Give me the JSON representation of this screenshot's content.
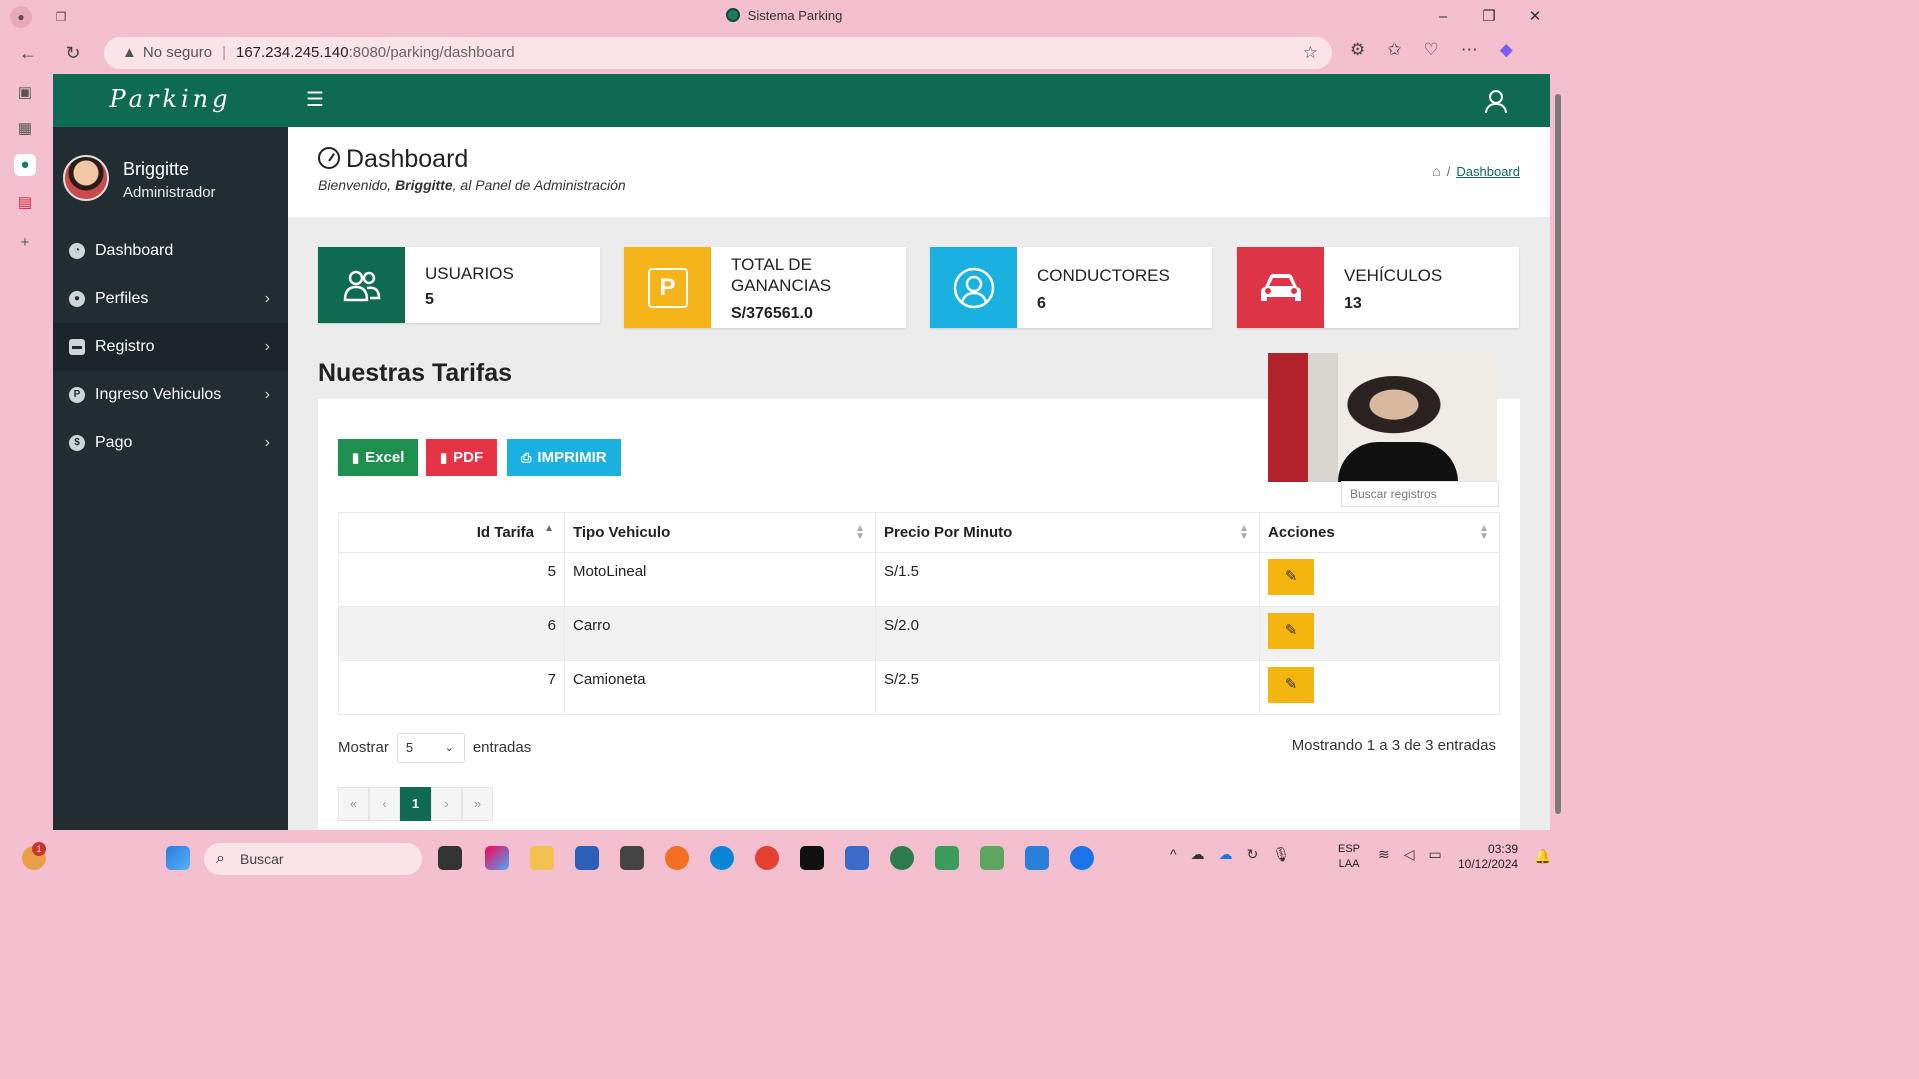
{
  "browser": {
    "tab_title": "Sistema Parking",
    "security": "No seguro",
    "url_host": "167.234.245.140",
    "url_path": ":8080/parking/dashboard"
  },
  "app": {
    "brand": "Parking",
    "user": {
      "name": "Briggitte",
      "role": "Administrador"
    },
    "menu": [
      {
        "label": "Dashboard",
        "icon": "dashboard-icon",
        "has_children": false
      },
      {
        "label": "Perfiles",
        "icon": "user-circle-icon",
        "has_children": true
      },
      {
        "label": "Registro",
        "icon": "car-icon",
        "has_children": true
      },
      {
        "label": "Ingreso Vehiculos",
        "icon": "parking-icon",
        "has_children": true
      },
      {
        "label": "Pago",
        "icon": "dollar-icon",
        "has_children": true
      }
    ]
  },
  "header": {
    "title": "Dashboard",
    "welcome_prefix": "Bienvenido, ",
    "welcome_name": "Briggitte",
    "welcome_suffix": ", al Panel de Administración",
    "breadcrumb_current": "Dashboard"
  },
  "stats": {
    "users": {
      "label": "USUARIOS",
      "value": "5",
      "color": "#0e6b52"
    },
    "earnings": {
      "label_line1": "TOTAL DE",
      "label_line2": "GANANCIAS",
      "value": "S/376561.0",
      "icon_letter": "P",
      "color": "#f5b51a"
    },
    "drivers": {
      "label": "CONDUCTORES",
      "value": "6",
      "color": "#1ab1e0"
    },
    "vehicles": {
      "label": "VEHÍCULOS",
      "value": "13",
      "color": "#dd3545"
    }
  },
  "tarifas": {
    "title": "Nuestras Tarifas",
    "buttons": {
      "excel": "Excel",
      "pdf": "PDF",
      "print": "IMPRIMIR"
    },
    "search_placeholder": "Buscar registros",
    "columns": [
      "Id Tarifa",
      "Tipo Vehiculo",
      "Precio Por Minuto",
      "Acciones"
    ],
    "rows": [
      {
        "id": "5",
        "tipo": "MotoLineal",
        "precio": "S/1.5"
      },
      {
        "id": "6",
        "tipo": "Carro",
        "precio": "S/2.0"
      },
      {
        "id": "7",
        "tipo": "Camioneta",
        "precio": "S/2.5"
      }
    ],
    "show_label": "Mostrar",
    "show_value": "5",
    "entries_label": "entradas",
    "info": "Mostrando 1 a 3 de 3 entradas",
    "pager": [
      "«",
      "‹",
      "1",
      "›",
      "»"
    ]
  },
  "taskbar": {
    "search": "Buscar",
    "lang_line1": "ESP",
    "lang_line2": "LAA",
    "time": "03:39",
    "date": "10/12/2024",
    "notification_count": "1"
  }
}
